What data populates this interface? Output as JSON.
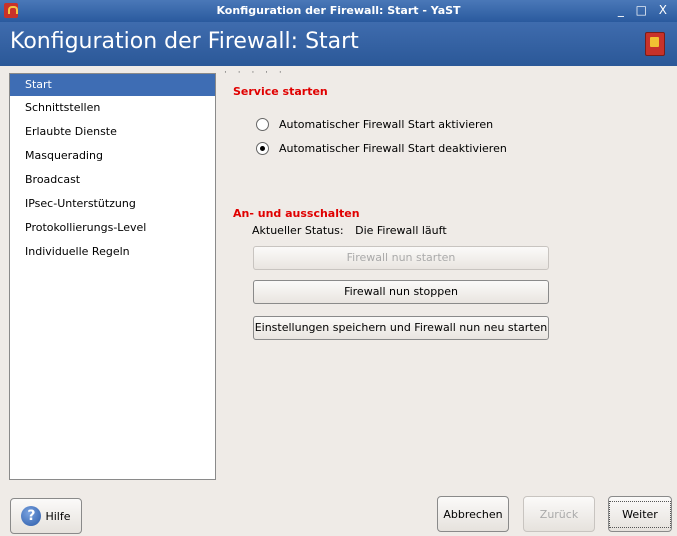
{
  "window": {
    "title": "Konfiguration der Firewall: Start - YaST",
    "controls": "_ □ X"
  },
  "header": {
    "title": "Konfiguration der Firewall: Start"
  },
  "sidebar": {
    "items": [
      {
        "label": "Start"
      },
      {
        "label": "Schnittstellen"
      },
      {
        "label": "Erlaubte Dienste"
      },
      {
        "label": "Masquerading"
      },
      {
        "label": "Broadcast"
      },
      {
        "label": "IPsec-Unterstützung"
      },
      {
        "label": "Protokollierungs-Level"
      },
      {
        "label": "Individuelle Regeln"
      }
    ]
  },
  "main": {
    "dots": "· · · · ·",
    "service_heading": "Service starten",
    "radio_enable": "Automatischer Firewall Start aktivieren",
    "radio_disable": "Automatischer Firewall Start deaktivieren",
    "toggle_heading": "An- und ausschalten",
    "status_label": "Aktueller Status:",
    "status_value": "Die Firewall läuft",
    "btn_start": "Firewall nun starten",
    "btn_stop": "Firewall nun stoppen",
    "btn_restart": "Einstellungen speichern und Firewall nun neu starten"
  },
  "footer": {
    "help": "Hilfe",
    "cancel": "Abbrechen",
    "back": "Zurück",
    "next": "Weiter"
  },
  "colors": {
    "accent": "#3e6db4",
    "heading_red": "#e00000"
  }
}
